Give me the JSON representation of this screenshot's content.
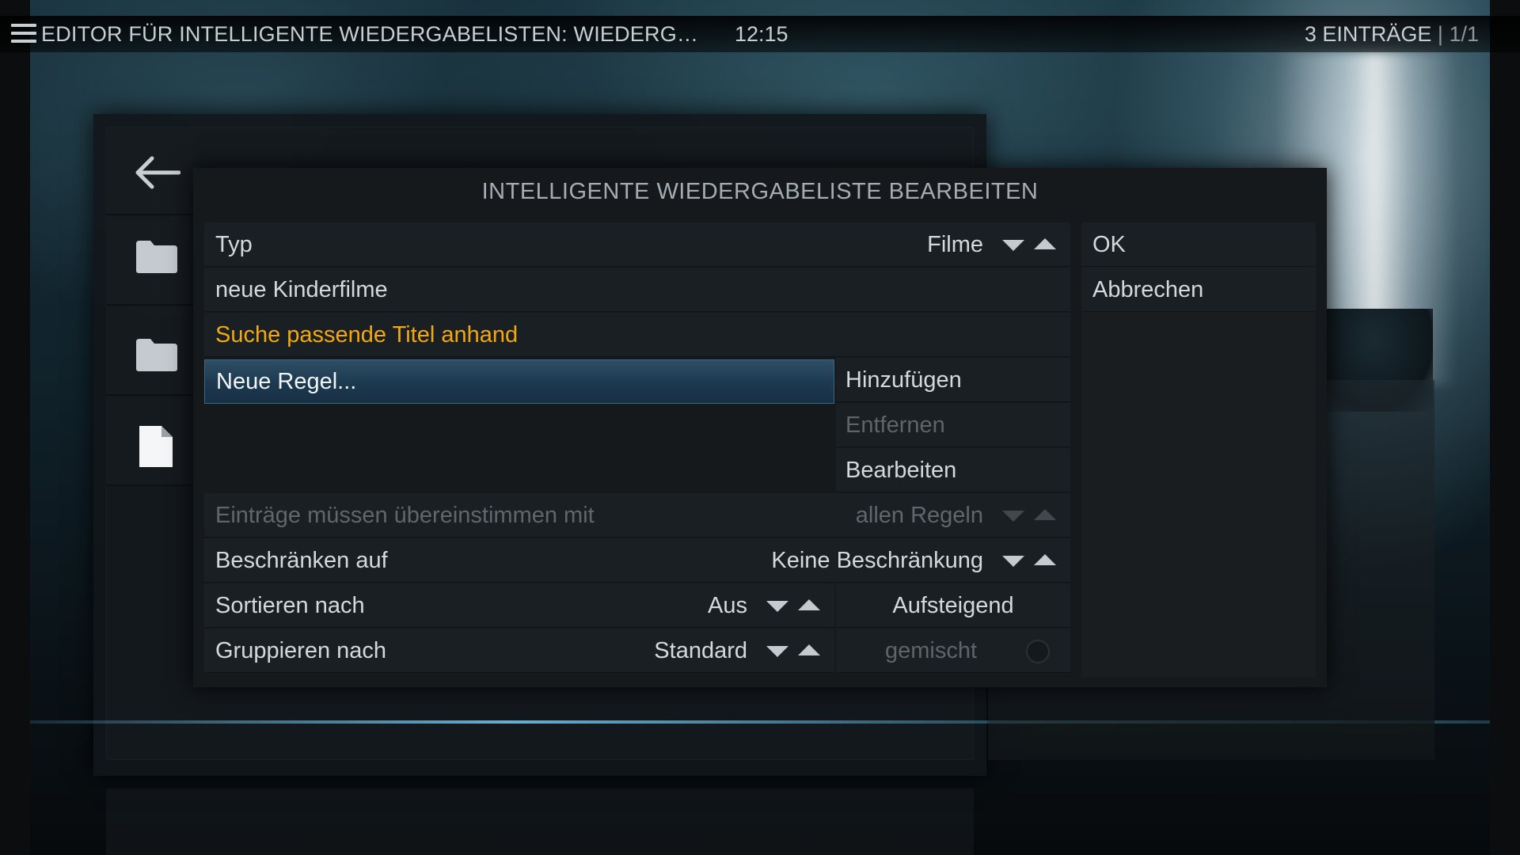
{
  "header": {
    "title": "EDITOR FÜR INTELLIGENTE WIEDERGABELISTEN: WIEDERGABELISTEN ...",
    "clock": "12:15",
    "item_count": "3 EINTRÄGE",
    "separator": " | ",
    "page": "1/1"
  },
  "side_nav": {
    "items": [
      {
        "icon": "back-arrow-icon"
      },
      {
        "icon": "folder-icon"
      },
      {
        "icon": "folder-icon"
      },
      {
        "icon": "file-icon"
      }
    ]
  },
  "dialog": {
    "title": "INTELLIGENTE WIEDERGABELISTE BEARBEITEN",
    "rows": {
      "type": {
        "label": "Typ",
        "value": "Filme"
      },
      "name": {
        "label": "neue Kinderfilme"
      },
      "match_header": {
        "label": "Suche passende Titel anhand"
      },
      "rule": {
        "label": "Neue Regel..."
      },
      "match": {
        "label": "Einträge müssen übereinstimmen mit",
        "value": "allen Regeln"
      },
      "limit": {
        "label": "Beschränken auf",
        "value": "Keine Beschränkung"
      },
      "sort": {
        "label": "Sortieren nach",
        "value": "Aus",
        "direction": "Aufsteigend"
      },
      "group": {
        "label": "Gruppieren nach",
        "value": "Standard",
        "mixed": "gemischt"
      }
    },
    "rule_buttons": {
      "add": "Hinzufügen",
      "remove": "Entfernen",
      "edit": "Bearbeiten"
    },
    "side_buttons": {
      "ok": "OK",
      "cancel": "Abbrechen"
    }
  },
  "colors": {
    "accent_orange": "#f4a80f",
    "focus_blue": "#1d3a50",
    "panel": "#1a1f23"
  }
}
